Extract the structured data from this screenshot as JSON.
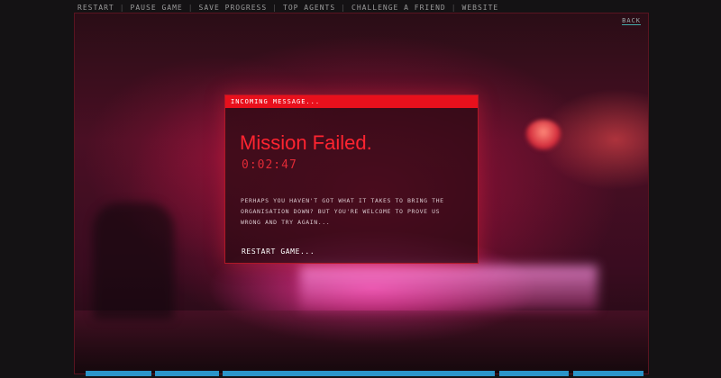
{
  "nav": {
    "items": [
      "RESTART",
      "PAUSE GAME",
      "SAVE PROGRESS",
      "TOP AGENTS",
      "CHALLENGE A FRIEND",
      "WEBSITE"
    ],
    "separator": "|"
  },
  "frame": {
    "back_label": "BACK"
  },
  "dialog": {
    "header": "INCOMING MESSAGE...",
    "title": "Mission Failed.",
    "timer": "0:02:47",
    "body": "PERHAPS YOU HAVEN'T GOT WHAT IT TAKES TO BRING THE ORGANISATION DOWN? BUT YOU'RE WELCOME TO PROVE US WRONG AND TRY AGAIN...",
    "restart_label": "RESTART GAME..."
  },
  "colors": {
    "accent_red": "#e8101c",
    "bar_blue": "#2b95c9"
  }
}
